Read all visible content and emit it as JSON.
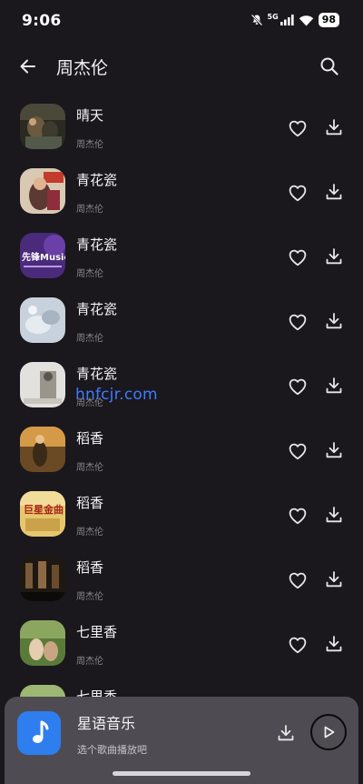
{
  "status_bar": {
    "time": "9:06",
    "network": "5G",
    "battery": "98"
  },
  "header": {
    "title": "周杰伦",
    "back_icon": "arrow-left-icon",
    "search_icon": "search-icon"
  },
  "songs": [
    {
      "title": "晴天",
      "artist": "周杰伦"
    },
    {
      "title": "青花瓷",
      "artist": "周杰伦"
    },
    {
      "title": "青花瓷",
      "artist": "周杰伦"
    },
    {
      "title": "青花瓷",
      "artist": "周杰伦"
    },
    {
      "title": "青花瓷",
      "artist": "周杰伦"
    },
    {
      "title": "稻香",
      "artist": "周杰伦"
    },
    {
      "title": "稻香",
      "artist": "周杰伦"
    },
    {
      "title": "稻香",
      "artist": "周杰伦"
    },
    {
      "title": "七里香",
      "artist": "周杰伦"
    },
    {
      "title": "七里香",
      "artist": ""
    }
  ],
  "cover_texts": {
    "cover2": "先锋Music",
    "cover6": "巨星金曲"
  },
  "watermark": "hnfcjr.com",
  "mini_player": {
    "title": "星语音乐",
    "subtitle": "选个歌曲播放吧",
    "accent": "#2f7ef0"
  },
  "colors": {
    "background": "#1a171d",
    "player_background": "#4e4b52"
  }
}
